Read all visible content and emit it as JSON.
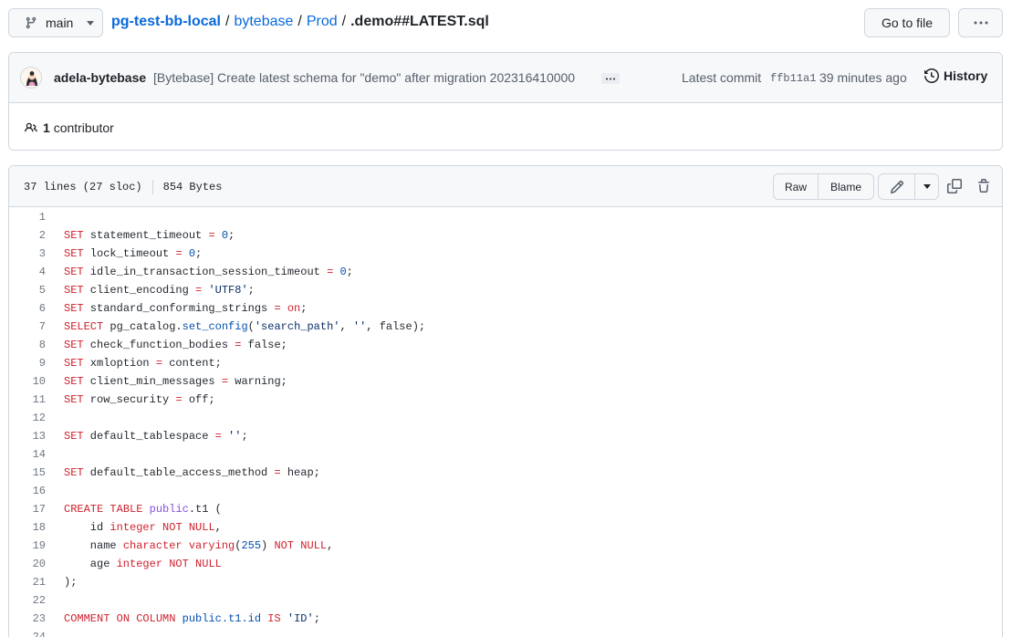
{
  "branch": {
    "name": "main"
  },
  "breadcrumb": {
    "repo": "pg-test-bb-local",
    "sep1": "/",
    "dir1": "bytebase",
    "sep2": "/",
    "dir2": "Prod",
    "sep3": "/",
    "file": ".demo##LATEST.sql"
  },
  "toolbar": {
    "goto_label": "Go to file",
    "more_label": "···"
  },
  "commit": {
    "author": "adela-bytebase",
    "message": "[Bytebase] Create latest schema for \"demo\" after migration 202316410000",
    "latest_label": "Latest commit",
    "sha": "ffb11a1",
    "time": "39 minutes ago",
    "history_label": "History"
  },
  "contributors": {
    "count": "1",
    "label": "contributor"
  },
  "file": {
    "lines": "37 lines (27 sloc)",
    "size": "854 Bytes",
    "raw_label": "Raw",
    "blame_label": "Blame"
  },
  "code_lines": [
    {
      "n": "1",
      "t": []
    },
    {
      "n": "2",
      "t": [
        [
          "kw",
          "SET"
        ],
        [
          "p",
          " statement_timeout "
        ],
        [
          "kw",
          "="
        ],
        [
          "p",
          " "
        ],
        [
          "num",
          "0"
        ],
        [
          "p",
          ";"
        ]
      ]
    },
    {
      "n": "3",
      "t": [
        [
          "kw",
          "SET"
        ],
        [
          "p",
          " lock_timeout "
        ],
        [
          "kw",
          "="
        ],
        [
          "p",
          " "
        ],
        [
          "num",
          "0"
        ],
        [
          "p",
          ";"
        ]
      ]
    },
    {
      "n": "4",
      "t": [
        [
          "kw",
          "SET"
        ],
        [
          "p",
          " idle_in_transaction_session_timeout "
        ],
        [
          "kw",
          "="
        ],
        [
          "p",
          " "
        ],
        [
          "num",
          "0"
        ],
        [
          "p",
          ";"
        ]
      ]
    },
    {
      "n": "5",
      "t": [
        [
          "kw",
          "SET"
        ],
        [
          "p",
          " client_encoding "
        ],
        [
          "kw",
          "="
        ],
        [
          "p",
          " "
        ],
        [
          "str",
          "'UTF8'"
        ],
        [
          "p",
          ";"
        ]
      ]
    },
    {
      "n": "6",
      "t": [
        [
          "kw",
          "SET"
        ],
        [
          "p",
          " standard_conforming_strings "
        ],
        [
          "kw",
          "="
        ],
        [
          "p",
          " "
        ],
        [
          "kw",
          "on"
        ],
        [
          "p",
          ";"
        ]
      ]
    },
    {
      "n": "7",
      "t": [
        [
          "kw",
          "SELECT"
        ],
        [
          "p",
          " pg_catalog."
        ],
        [
          "ns",
          "set_config"
        ],
        [
          "p",
          "("
        ],
        [
          "str",
          "'search_path'"
        ],
        [
          "p",
          ", "
        ],
        [
          "str",
          "''"
        ],
        [
          "p",
          ", false);"
        ]
      ]
    },
    {
      "n": "8",
      "t": [
        [
          "kw",
          "SET"
        ],
        [
          "p",
          " check_function_bodies "
        ],
        [
          "kw",
          "="
        ],
        [
          "p",
          " false;"
        ]
      ]
    },
    {
      "n": "9",
      "t": [
        [
          "kw",
          "SET"
        ],
        [
          "p",
          " xmloption "
        ],
        [
          "kw",
          "="
        ],
        [
          "p",
          " content;"
        ]
      ]
    },
    {
      "n": "10",
      "t": [
        [
          "kw",
          "SET"
        ],
        [
          "p",
          " client_min_messages "
        ],
        [
          "kw",
          "="
        ],
        [
          "p",
          " warning;"
        ]
      ]
    },
    {
      "n": "11",
      "t": [
        [
          "kw",
          "SET"
        ],
        [
          "p",
          " row_security "
        ],
        [
          "kw",
          "="
        ],
        [
          "p",
          " off;"
        ]
      ]
    },
    {
      "n": "12",
      "t": []
    },
    {
      "n": "13",
      "t": [
        [
          "kw",
          "SET"
        ],
        [
          "p",
          " default_tablespace "
        ],
        [
          "kw",
          "="
        ],
        [
          "p",
          " "
        ],
        [
          "str",
          "''"
        ],
        [
          "p",
          ";"
        ]
      ]
    },
    {
      "n": "14",
      "t": []
    },
    {
      "n": "15",
      "t": [
        [
          "kw",
          "SET"
        ],
        [
          "p",
          " default_table_access_method "
        ],
        [
          "kw",
          "="
        ],
        [
          "p",
          " heap;"
        ]
      ]
    },
    {
      "n": "16",
      "t": []
    },
    {
      "n": "17",
      "t": [
        [
          "kw",
          "CREATE"
        ],
        [
          "p",
          " "
        ],
        [
          "kw",
          "TABLE"
        ],
        [
          "p",
          " "
        ],
        [
          "fn",
          "public"
        ],
        [
          "p",
          ".t1 ("
        ]
      ]
    },
    {
      "n": "18",
      "t": [
        [
          "p",
          "    id "
        ],
        [
          "kw",
          "integer"
        ],
        [
          "p",
          " "
        ],
        [
          "kw",
          "NOT NULL"
        ],
        [
          "p",
          ","
        ]
      ]
    },
    {
      "n": "19",
      "t": [
        [
          "p",
          "    name "
        ],
        [
          "kw",
          "character varying"
        ],
        [
          "p",
          "("
        ],
        [
          "num",
          "255"
        ],
        [
          "p",
          ") "
        ],
        [
          "kw",
          "NOT NULL"
        ],
        [
          "p",
          ","
        ]
      ]
    },
    {
      "n": "20",
      "t": [
        [
          "p",
          "    age "
        ],
        [
          "kw",
          "integer"
        ],
        [
          "p",
          " "
        ],
        [
          "kw",
          "NOT NULL"
        ]
      ]
    },
    {
      "n": "21",
      "t": [
        [
          "p",
          ");"
        ]
      ]
    },
    {
      "n": "22",
      "t": []
    },
    {
      "n": "23",
      "t": [
        [
          "kw",
          "COMMENT"
        ],
        [
          "p",
          " "
        ],
        [
          "kw",
          "ON"
        ],
        [
          "p",
          " "
        ],
        [
          "kw",
          "COLUMN"
        ],
        [
          "p",
          " "
        ],
        [
          "ns",
          "public.t1.id"
        ],
        [
          "p",
          " "
        ],
        [
          "kw",
          "IS"
        ],
        [
          "p",
          " "
        ],
        [
          "str",
          "'ID'"
        ],
        [
          "p",
          ";"
        ]
      ]
    },
    {
      "n": "24",
      "t": []
    }
  ]
}
